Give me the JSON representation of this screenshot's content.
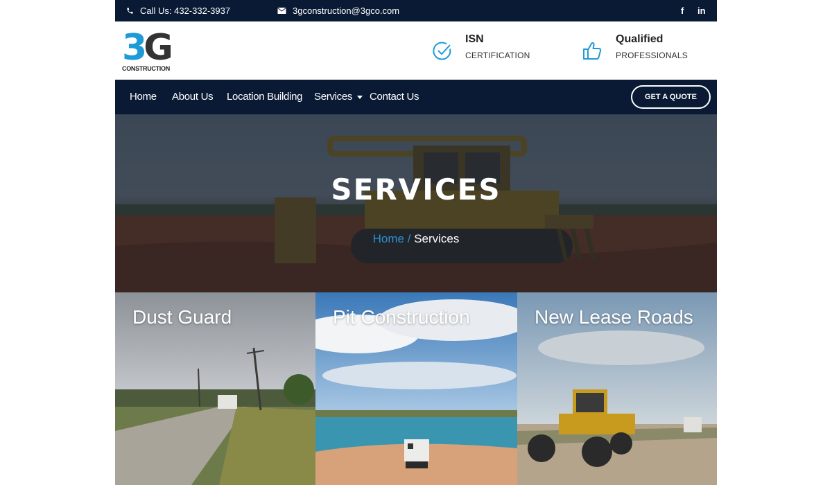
{
  "topbar": {
    "phone": "Call Us: 432-332-3937",
    "email": "3gconstruction@3gco.com",
    "social": {
      "facebook": "f",
      "linkedin": "in"
    }
  },
  "header": {
    "logo": {
      "mark_a": "3",
      "mark_b": "G",
      "sub": "CONSTRUCTION"
    },
    "features": [
      {
        "title": "ISN",
        "subtitle": "CERTIFICATION",
        "icon": "check-circle-icon"
      },
      {
        "title": "Qualified",
        "subtitle": "PROFESSIONALS",
        "icon": "thumbs-up-icon"
      }
    ]
  },
  "nav": {
    "items": [
      "Home",
      "About Us",
      "Location Building",
      "Services",
      "Contact Us"
    ],
    "cta": "GET A QUOTE"
  },
  "hero": {
    "title": "SERVICES",
    "breadcrumb": {
      "home": "Home",
      "separator": "/",
      "current": "Services"
    }
  },
  "cards": [
    {
      "label": "Dust Guard"
    },
    {
      "label": "Pit Construction"
    },
    {
      "label": "New Lease Roads"
    }
  ],
  "colors": {
    "navy": "#0a1a35",
    "accent_blue": "#1e9ad6"
  }
}
